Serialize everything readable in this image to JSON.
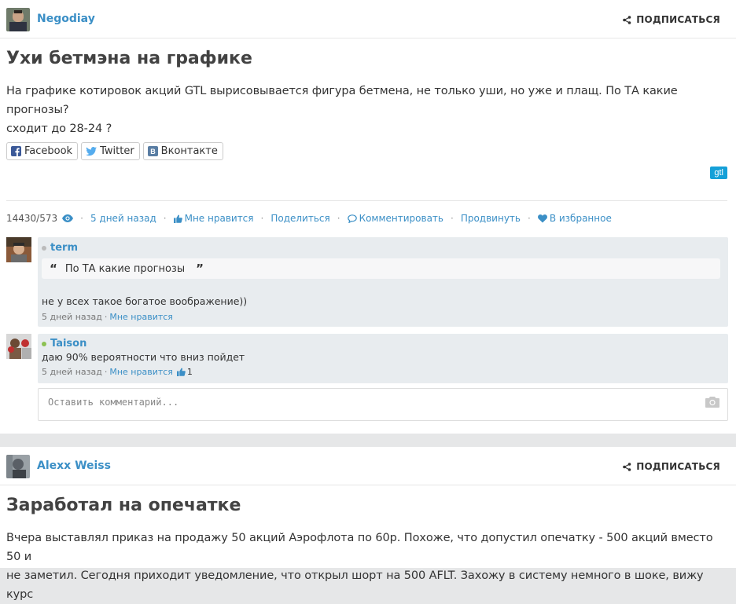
{
  "post1": {
    "author": "Negodiay",
    "subscribe_label": "ПОДПИСАТЬСЯ",
    "title": "Ухи бетмэна на графике",
    "body_line1": "На графике котировок акций GTL вырисовывается фигура бетмена, не только уши, но уже и плащ. По ТА какие прогнозы?",
    "body_line2": "сходит до 28-24 ?",
    "share": [
      {
        "label": "Facebook",
        "icon": "facebook-icon"
      },
      {
        "label": "Twitter",
        "icon": "twitter-icon"
      },
      {
        "label": "Вконтакте",
        "icon": "vk-icon"
      }
    ],
    "tag": "gtl",
    "meta": {
      "views": "14430/573",
      "time": "5 дней назад",
      "like": "Мне нравится",
      "share": "Поделиться",
      "comment": "Комментировать",
      "promote": "Продвинуть",
      "favorite": "В избранное"
    },
    "comments": [
      {
        "author": "term",
        "status_color": "#bbbbbb",
        "quote": "По ТА какие прогнозы",
        "text": "не у всех такое богатое воображение))",
        "time": "5 дней назад",
        "like": "Мне нравится"
      },
      {
        "author": "Taison",
        "status_color": "#8cc152",
        "text": "даю 90% вероятности что вниз пойдет",
        "time": "5 дней назад",
        "like": "Мне нравится",
        "likes_count": "1"
      }
    ],
    "comment_placeholder": "Оставить комментарий..."
  },
  "post2": {
    "author": "Alexx Weiss",
    "subscribe_label": "ПОДПИСАТЬСЯ",
    "title": "Заработал на опечатке",
    "body_line1": "Вчера выставлял приказ на продажу 50 акций Аэрофлота по 60р. Похоже, что допустил опечатку - 500 акций вместо 50 и",
    "body_line2": "не заметил. Сегодня приходит уведомление, что открыл шорт на 500 AFLT. Захожу в систему немного в шоке, вижу курс"
  },
  "colors": {
    "link": "#3b8fc6",
    "tag_bg": "#15a0d8",
    "comment_bg": "#e8ecef"
  }
}
